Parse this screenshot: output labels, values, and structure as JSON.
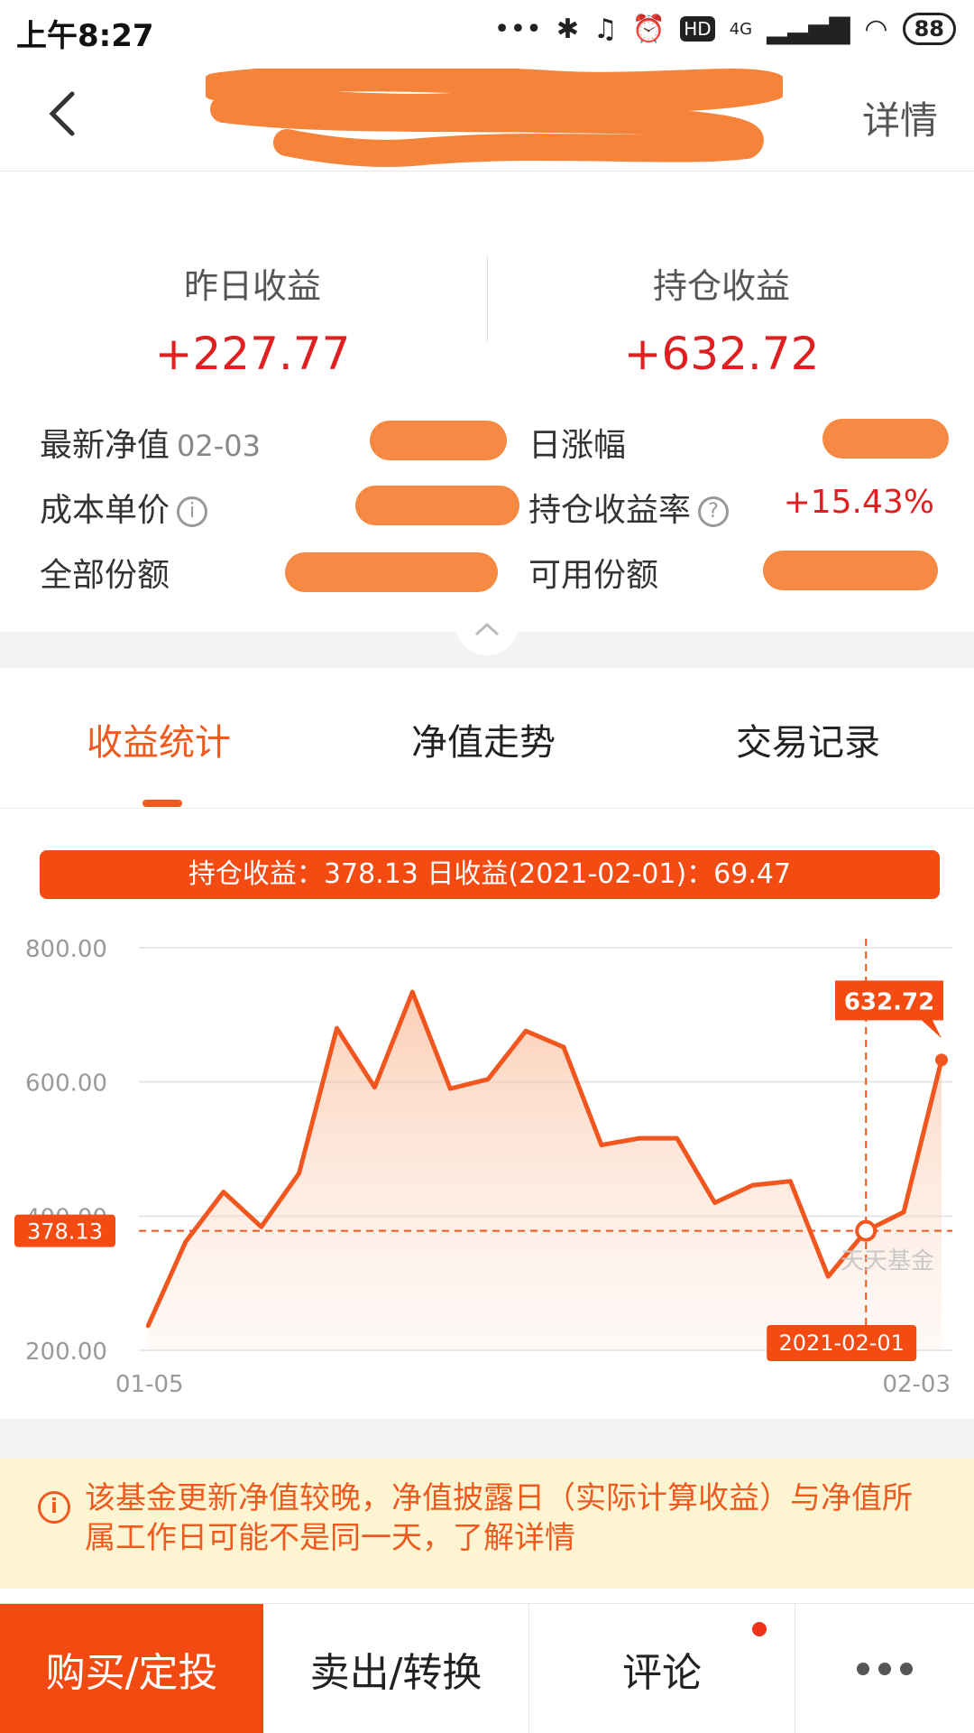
{
  "status_bar": {
    "time": "上午8:27",
    "network": "4G",
    "hd": "HD",
    "battery": "88"
  },
  "header": {
    "back_icon": "chevron-left-icon",
    "detail_label": "详情"
  },
  "summary": {
    "yesterday_label": "昨日收益",
    "yesterday_value": "+227.77",
    "holding_label": "持仓收益",
    "holding_value": "+632.72"
  },
  "info": {
    "latest_nav_label": "最新净值",
    "latest_nav_date": "02-03",
    "daily_change_label": "日涨幅",
    "cost_label": "成本单价",
    "holding_rate_label": "持仓收益率",
    "holding_rate_value": "+15.43%",
    "total_shares_label": "全部份额",
    "available_shares_label": "可用份额"
  },
  "tabs": [
    {
      "label": "收益统计",
      "active": true
    },
    {
      "label": "净值走势",
      "active": false
    },
    {
      "label": "交易记录",
      "active": false
    }
  ],
  "chart_banner": "持仓收益：378.13   日收益(2021-02-01)：69.47",
  "chart_data": {
    "type": "area",
    "title": "",
    "x_start": "01-05",
    "x_end": "02-03",
    "y_ticks": [
      "800.00",
      "600.00",
      "400.00",
      "200.00"
    ],
    "ylim": [
      200,
      800
    ],
    "values": [
      236,
      362,
      436,
      384,
      464,
      680,
      592,
      734,
      590,
      604,
      676,
      652,
      506,
      516,
      516,
      420,
      446,
      452,
      310,
      378,
      406,
      632.72
    ],
    "selected_index": 19,
    "selected_value_label": "378.13",
    "selected_date_label": "2021-02-01",
    "last_value_label": "632.72",
    "watermark": "天天基金",
    "line_color": "#f0561d",
    "grid": true
  },
  "notice": {
    "icon": "info-icon",
    "text": "该基金更新净值较晚，净值披露日（实际计算收益）与净值所属工作日可能不是同一天，了解详情"
  },
  "bottom_bar": {
    "buy_label": "购买/定投",
    "sell_label": "卖出/转换",
    "comment_label": "评论",
    "more_icon": "more-icon"
  }
}
